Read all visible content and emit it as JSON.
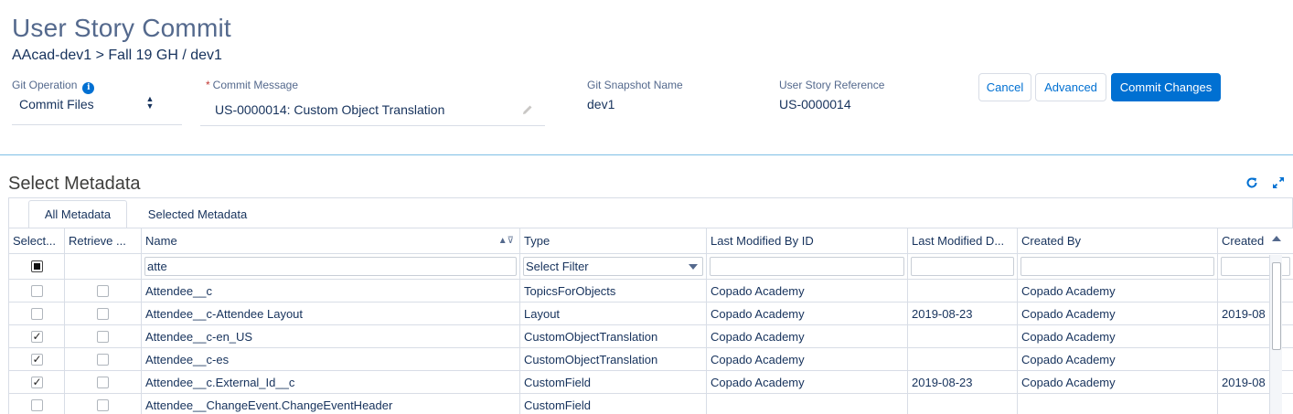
{
  "header": {
    "title": "User Story Commit",
    "breadcrumb": "AAcad-dev1 > Fall 19 GH  / dev1"
  },
  "form": {
    "git_operation": {
      "label": "Git Operation",
      "value": "Commit Files"
    },
    "commit_message": {
      "label": "Commit Message",
      "required_mark": "*",
      "value": "US-0000014: Custom Object Translation"
    },
    "snapshot": {
      "label": "Git Snapshot Name",
      "value": "dev1"
    },
    "story_ref": {
      "label": "User Story Reference",
      "value": "US-0000014"
    }
  },
  "buttons": {
    "cancel": "Cancel",
    "advanced": "Advanced",
    "commit": "Commit Changes"
  },
  "metadata": {
    "title": "Select Metadata",
    "tabs": [
      "All Metadata",
      "Selected Metadata"
    ],
    "columns": [
      "Select...",
      "Retrieve ...",
      "Name",
      "Type",
      "Last Modified By ID",
      "Last Modified D...",
      "Created By",
      "Created"
    ],
    "filters": {
      "name": "atte",
      "type": "Select Filter"
    },
    "rows": [
      {
        "selected": false,
        "name": "Attendee__c",
        "type": "TopicsForObjects",
        "modified_by": "Copado Academy",
        "modified_date": "",
        "created_by": "Copado Academy",
        "created": ""
      },
      {
        "selected": false,
        "name": "Attendee__c-Attendee Layout",
        "type": "Layout",
        "modified_by": "Copado Academy",
        "modified_date": "2019-08-23",
        "created_by": "Copado Academy",
        "created": "2019-08"
      },
      {
        "selected": true,
        "name": "Attendee__c-en_US",
        "type": "CustomObjectTranslation",
        "modified_by": "Copado Academy",
        "modified_date": "",
        "created_by": "Copado Academy",
        "created": ""
      },
      {
        "selected": true,
        "name": "Attendee__c-es",
        "type": "CustomObjectTranslation",
        "modified_by": "Copado Academy",
        "modified_date": "",
        "created_by": "Copado Academy",
        "created": ""
      },
      {
        "selected": true,
        "name": "Attendee__c.External_Id__c",
        "type": "CustomField",
        "modified_by": "Copado Academy",
        "modified_date": "2019-08-23",
        "created_by": "Copado Academy",
        "created": "2019-08"
      },
      {
        "selected": false,
        "name": "Attendee__ChangeEvent.ChangeEventHeader",
        "type": "CustomField",
        "modified_by": "",
        "modified_date": "",
        "created_by": "",
        "created": ""
      }
    ]
  },
  "colors": {
    "accent": "#0070d2",
    "title": "#54698d",
    "text": "#16325c",
    "border": "#d8dde6"
  },
  "icons": [
    "info-icon",
    "pencil-icon",
    "refresh-icon",
    "expand-icon",
    "sort-icon",
    "filter-icon"
  ]
}
